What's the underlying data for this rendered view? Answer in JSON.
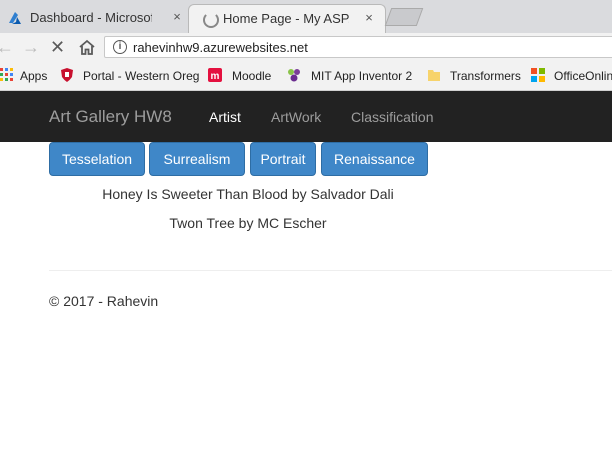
{
  "browser": {
    "tabs": [
      {
        "title": "Dashboard - Microsoft A",
        "icon": "azure-icon"
      },
      {
        "title": "Home Page - My ASP.NE",
        "icon": "loading-spinner-icon"
      }
    ],
    "address": "rahevinhw9.azurewebsites.net",
    "bookmarks": [
      {
        "label": "Apps",
        "icon": "apps-grid-icon"
      },
      {
        "label": "Portal - Western Oreg",
        "icon": "shield-icon"
      },
      {
        "label": "Moodle",
        "icon": "moodle-icon"
      },
      {
        "label": "MIT App Inventor 2",
        "icon": "app-inventor-icon"
      },
      {
        "label": "Transformers",
        "icon": "folder-icon"
      },
      {
        "label": "OfficeOnlin",
        "icon": "office-icon"
      }
    ],
    "close_glyph": "×"
  },
  "site": {
    "brand": "Art Gallery HW8",
    "nav": [
      "Artist",
      "ArtWork",
      "Classification"
    ],
    "active_nav": "Artist",
    "filters": [
      "Tesselation",
      "Surrealism",
      "Portrait",
      "Renaissance"
    ],
    "items": [
      "Honey Is Sweeter Than Blood by Salvador Dali",
      "Twon Tree by MC Escher"
    ],
    "footer": "© 2017 - Rahevin"
  },
  "colors": {
    "navbar_bg": "#222222",
    "button_bg": "#3f87c8",
    "nav_link": "#9d9d9d",
    "nav_active": "#ffffff"
  }
}
